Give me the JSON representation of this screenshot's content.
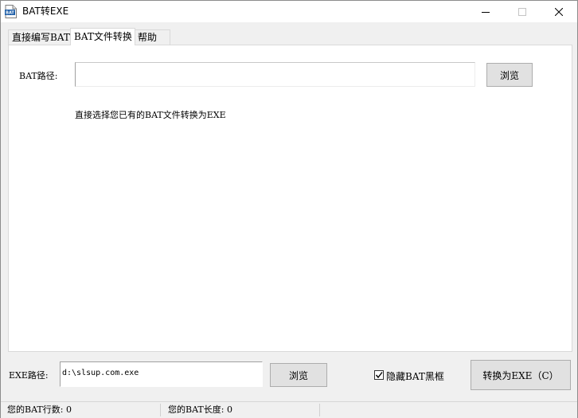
{
  "window": {
    "title": "BAT转EXE",
    "icon": "bat-file-icon",
    "icon_text": "BAT"
  },
  "tabs": [
    {
      "label": "直接编写BAT",
      "active": false
    },
    {
      "label": "BAT文件转换",
      "active": true
    },
    {
      "label": "帮助",
      "active": false
    }
  ],
  "bat_panel": {
    "path_label": "BAT路径:",
    "path_value": "",
    "browse_label": "浏览",
    "hint": "直接选择您已有的BAT文件转换为EXE"
  },
  "bottom": {
    "exe_label": "EXE路径:",
    "exe_value": "d:\\slsup.com.exe",
    "browse_label": "浏览",
    "hide_label": "隐藏BAT黑框",
    "hide_checked": true,
    "convert_label": "转换为EXE（C）"
  },
  "status": {
    "lines": "您的BAT行数: 0",
    "length": "您的BAT长度: 0"
  },
  "colors": {
    "window_bg": "#f0f0f0",
    "panel_bg": "#ffffff",
    "icon_blue": "#1f5fa8"
  }
}
